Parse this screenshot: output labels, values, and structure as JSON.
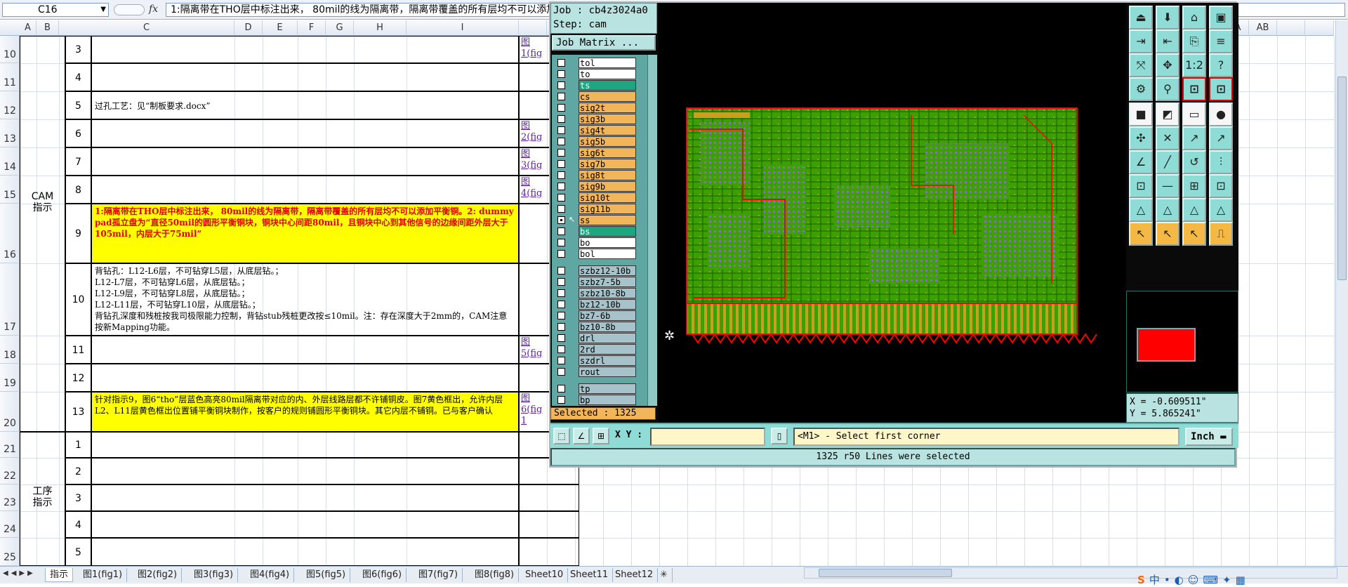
{
  "formula_bar": {
    "name_box": "C16",
    "fx_label": "fx",
    "formula_text": "1:隔离带在THO层中标注出来， 80mil的线为隔离带，隔离带覆盖的所有层均不可以添加平衡铜。2: dummy pad孤立盘为“直径50mil的圆形平衡铜块，铜块中心间距80mil，且铜块中心到其他信号的边缘间距外层大于105mil，内层大于75mil”",
    "formula_tail": "层大于75mil”"
  },
  "columns": [
    "A",
    "B",
    "C",
    "D",
    "E",
    "F",
    "G",
    "H",
    "I",
    "",
    "",
    "",
    "",
    "",
    "",
    "",
    "",
    "",
    "",
    "",
    "",
    "",
    "",
    "",
    "",
    "AA",
    "AB"
  ],
  "rows": [
    "10",
    "11",
    "12",
    "13",
    "14",
    "15",
    "16",
    "17",
    "18",
    "19",
    "20",
    "21",
    "22",
    "23",
    "24",
    "25"
  ],
  "sheet": {
    "group_cam": "CAM\n指示",
    "group_process": "工序\n指示",
    "items": [
      {
        "num": "3",
        "text": "",
        "link": "图\n1(fig"
      },
      {
        "num": "4",
        "text": "",
        "link": ""
      },
      {
        "num": "5",
        "text": "过孔工艺：见“制板要求.docx”",
        "link": ""
      },
      {
        "num": "6",
        "text": "",
        "link": "图\n2(fig"
      },
      {
        "num": "7",
        "text": "",
        "link": "图\n3(fig"
      },
      {
        "num": "8",
        "text": "",
        "link": "图\n4(fig"
      },
      {
        "num": "9",
        "text": "1:隔离带在THO层中标注出来， 80mil的线为隔离带，隔离带覆盖的所有层均不可以添加平衡铜。2: dummy pad孤立盘为“直径50mil的圆形平衡铜块，铜块中心间距80mil，且铜块中心到其他信号的边缘间距外层大于105mil，内层大于75mil”",
        "link": ""
      },
      {
        "num": "10",
        "text": "背钻孔：L12-L6层，不可钻穿L5层，从底层钻。；\nL12-L7层，不可钻穿L6层，从底层钻。；\nL12-L9层，不可钻穿L8层，从底层钻。；\nL12-L11层，不可钻穿L10层，从底层钻。；\n背钻孔深度和残桩按我司极限能力控制，背钻stub残桩更改按≤10mil。注：存在深度大于2mm的，CAM注意按新Mapping功能。",
        "link": ""
      },
      {
        "num": "11",
        "text": "",
        "link": "图\n5(fig"
      },
      {
        "num": "12",
        "text": "",
        "link": ""
      },
      {
        "num": "13",
        "text": "针对指示9，图6“tho”层蓝色高亮80mil隔离带对应的内、外层线路层都不许铺铜皮。图7黄色框出，允许内层L2、L11层黄色框出位置铺平衡铜块制作，按客户的规则铺圆形平衡铜块。其它内层不铺铜。已与客户确认",
        "link": "图\n6(fig\n1"
      },
      {
        "num": "1",
        "text": "",
        "link": ""
      },
      {
        "num": "2",
        "text": "",
        "link": ""
      },
      {
        "num": "3",
        "text": "",
        "link": ""
      },
      {
        "num": "4",
        "text": "",
        "link": ""
      },
      {
        "num": "5",
        "text": "",
        "link": ""
      }
    ]
  },
  "sheet_tabs": [
    "指示",
    "图1(fig1)",
    "图2(fig2)",
    "图3(fig3)",
    "图4(fig4)",
    "图5(fig5)",
    "图6(fig6)",
    "图7(fig7)",
    "图8(fig8)",
    "Sheet10",
    "Sheet11",
    "Sheet12"
  ],
  "cam": {
    "job_label": "Job : cb4z3024a0",
    "step_label": "Step: cam",
    "job_matrix": "Job Matrix ...",
    "layers": [
      {
        "name": "tol",
        "color": "#ffffff"
      },
      {
        "name": "to",
        "color": "#ffffff"
      },
      {
        "name": "ts",
        "color": "#1fa57f"
      },
      {
        "name": "cs",
        "color": "#f2b55a"
      },
      {
        "name": "sig2t",
        "color": "#f2b55a"
      },
      {
        "name": "sig3b",
        "color": "#f2b55a"
      },
      {
        "name": "sig4t",
        "color": "#f2b55a"
      },
      {
        "name": "sig5b",
        "color": "#f2b55a"
      },
      {
        "name": "sig6t",
        "color": "#f2b55a"
      },
      {
        "name": "sig7b",
        "color": "#f2b55a"
      },
      {
        "name": "sig8t",
        "color": "#f2b55a"
      },
      {
        "name": "sig9b",
        "color": "#f2b55a"
      },
      {
        "name": "sig10t",
        "color": "#f2b55a"
      },
      {
        "name": "sig11b",
        "color": "#f2b55a"
      },
      {
        "name": "ss",
        "color": "#f2b55a"
      },
      {
        "name": "bs",
        "color": "#1fa57f"
      },
      {
        "name": "bo",
        "color": "#ffffff"
      },
      {
        "name": "bol",
        "color": "#ffffff"
      },
      {
        "name": "szbz12-10b",
        "color": "#a6c3cb"
      },
      {
        "name": "szbz7-5b",
        "color": "#a6c3cb"
      },
      {
        "name": "szbz10-8b",
        "color": "#a6c3cb"
      },
      {
        "name": "bz12-10b",
        "color": "#a6c3cb"
      },
      {
        "name": "bz7-6b",
        "color": "#a6c3cb"
      },
      {
        "name": "bz10-8b",
        "color": "#a6c3cb"
      },
      {
        "name": "drl",
        "color": "#a6c3cb"
      },
      {
        "name": "2rd",
        "color": "#a6c3cb"
      },
      {
        "name": "szdrl",
        "color": "#a6c3cb"
      },
      {
        "name": "rout",
        "color": "#a6c3cb"
      },
      {
        "name": "tp",
        "color": "#a6c3cb"
      },
      {
        "name": "bp",
        "color": "#a6c3cb"
      }
    ],
    "selected_count": "Selected : 1325",
    "xy_label": "X Y :",
    "xy_value": "",
    "prompt": "<M1> - Select first corner",
    "units": "Inch",
    "coord_x": "X = -0.609511\"",
    "coord_y": "Y = 5.865241\"",
    "status": "1325 r50 Lines were selected",
    "colors": {
      "board": "#3da000",
      "selection": "#ff0000",
      "pads": "#8a6bd6"
    }
  }
}
